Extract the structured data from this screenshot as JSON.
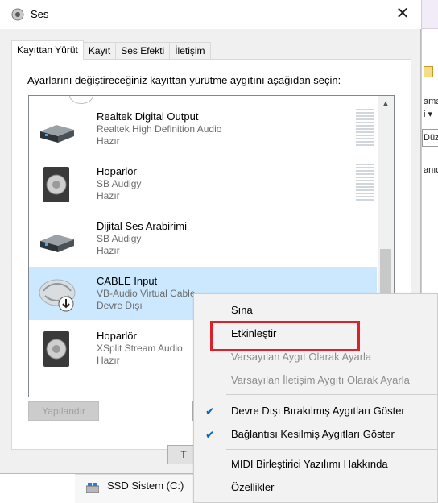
{
  "window": {
    "title": "Ses",
    "close_glyph": "✕"
  },
  "tabs": [
    {
      "label": "Kayıttan Yürüt",
      "active": true
    },
    {
      "label": "Kayıt",
      "active": false
    },
    {
      "label": "Ses Efekti",
      "active": false
    },
    {
      "label": "İletişim",
      "active": false
    }
  ],
  "instructions": "Ayarlarını değiştireceğiniz kayıttan yürütme aygıtını aşağıdan seçin:",
  "devices": [
    {
      "name": "Realtek Digital Output",
      "sub": "Realtek High Definition Audio",
      "status": "Hazır",
      "icon": "digital-output-icon"
    },
    {
      "name": "Hoparlör",
      "sub": "SB Audigy",
      "status": "Hazır",
      "icon": "speaker-icon"
    },
    {
      "name": "Dijital Ses Arabirimi",
      "sub": "SB Audigy",
      "status": "Hazır",
      "icon": "digital-output-icon"
    },
    {
      "name": "CABLE Input",
      "sub": "VB-Audio Virtual Cable",
      "status": "Devre Dışı",
      "icon": "cable-input-icon",
      "selected": true
    },
    {
      "name": "Hoparlör",
      "sub": "XSplit Stream Audio",
      "status": "Hazır",
      "icon": "speaker-icon"
    }
  ],
  "buttons": {
    "configure": "Yapılandır",
    "ok_partial": "T"
  },
  "context_menu": {
    "items": [
      {
        "label": "Sına",
        "disabled": false
      },
      {
        "label": "Etkinleştir",
        "disabled": false,
        "highlighted": true
      },
      {
        "label": "Varsayılan Aygıt Olarak Ayarla",
        "disabled": true
      },
      {
        "label": "Varsayılan İletişim Aygıtı Olarak Ayarla",
        "disabled": true
      },
      {
        "label": "Devre Dışı Bırakılmış Aygıtları Göster",
        "checked": true
      },
      {
        "label": "Bağlantısı Kesilmiş Aygıtları Göster",
        "checked": true
      },
      {
        "label": "MIDI Birleştirici Yazılımı Hakkında",
        "disabled": false
      },
      {
        "label": "Özellikler",
        "disabled": false
      }
    ],
    "check_glyph": "✔"
  },
  "background": {
    "right_texts": [
      "ama",
      "i ▾",
      "Düz",
      "anıc"
    ],
    "drive_label": "SSD Sistem (C:)"
  },
  "colors": {
    "selection": "#cce8ff",
    "highlight_box": "#d9232a",
    "check": "#0067c0"
  }
}
